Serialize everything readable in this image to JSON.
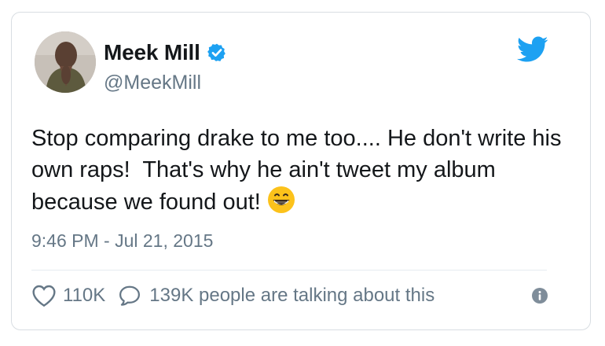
{
  "tweet": {
    "author_name": "Meek Mill",
    "author_handle": "@MeekMill",
    "verified_icon": "verified-badge-icon",
    "text": "Stop comparing drake to me too.... He don't write his own raps!  That's why he ain't tweet my album because we found out!",
    "emoji": "grinning-face-icon",
    "timestamp": "9:46 PM - Jul 21, 2015",
    "like_count": "110K",
    "reply_text": "139K people are talking about this"
  },
  "icons": {
    "brand": "twitter-bird-icon",
    "like": "heart-icon",
    "reply": "speech-bubble-icon",
    "info": "info-icon"
  },
  "colors": {
    "twitter_blue": "#1da1f2",
    "text_primary": "#14171a",
    "text_secondary": "#657786",
    "border": "#d8dde2"
  }
}
